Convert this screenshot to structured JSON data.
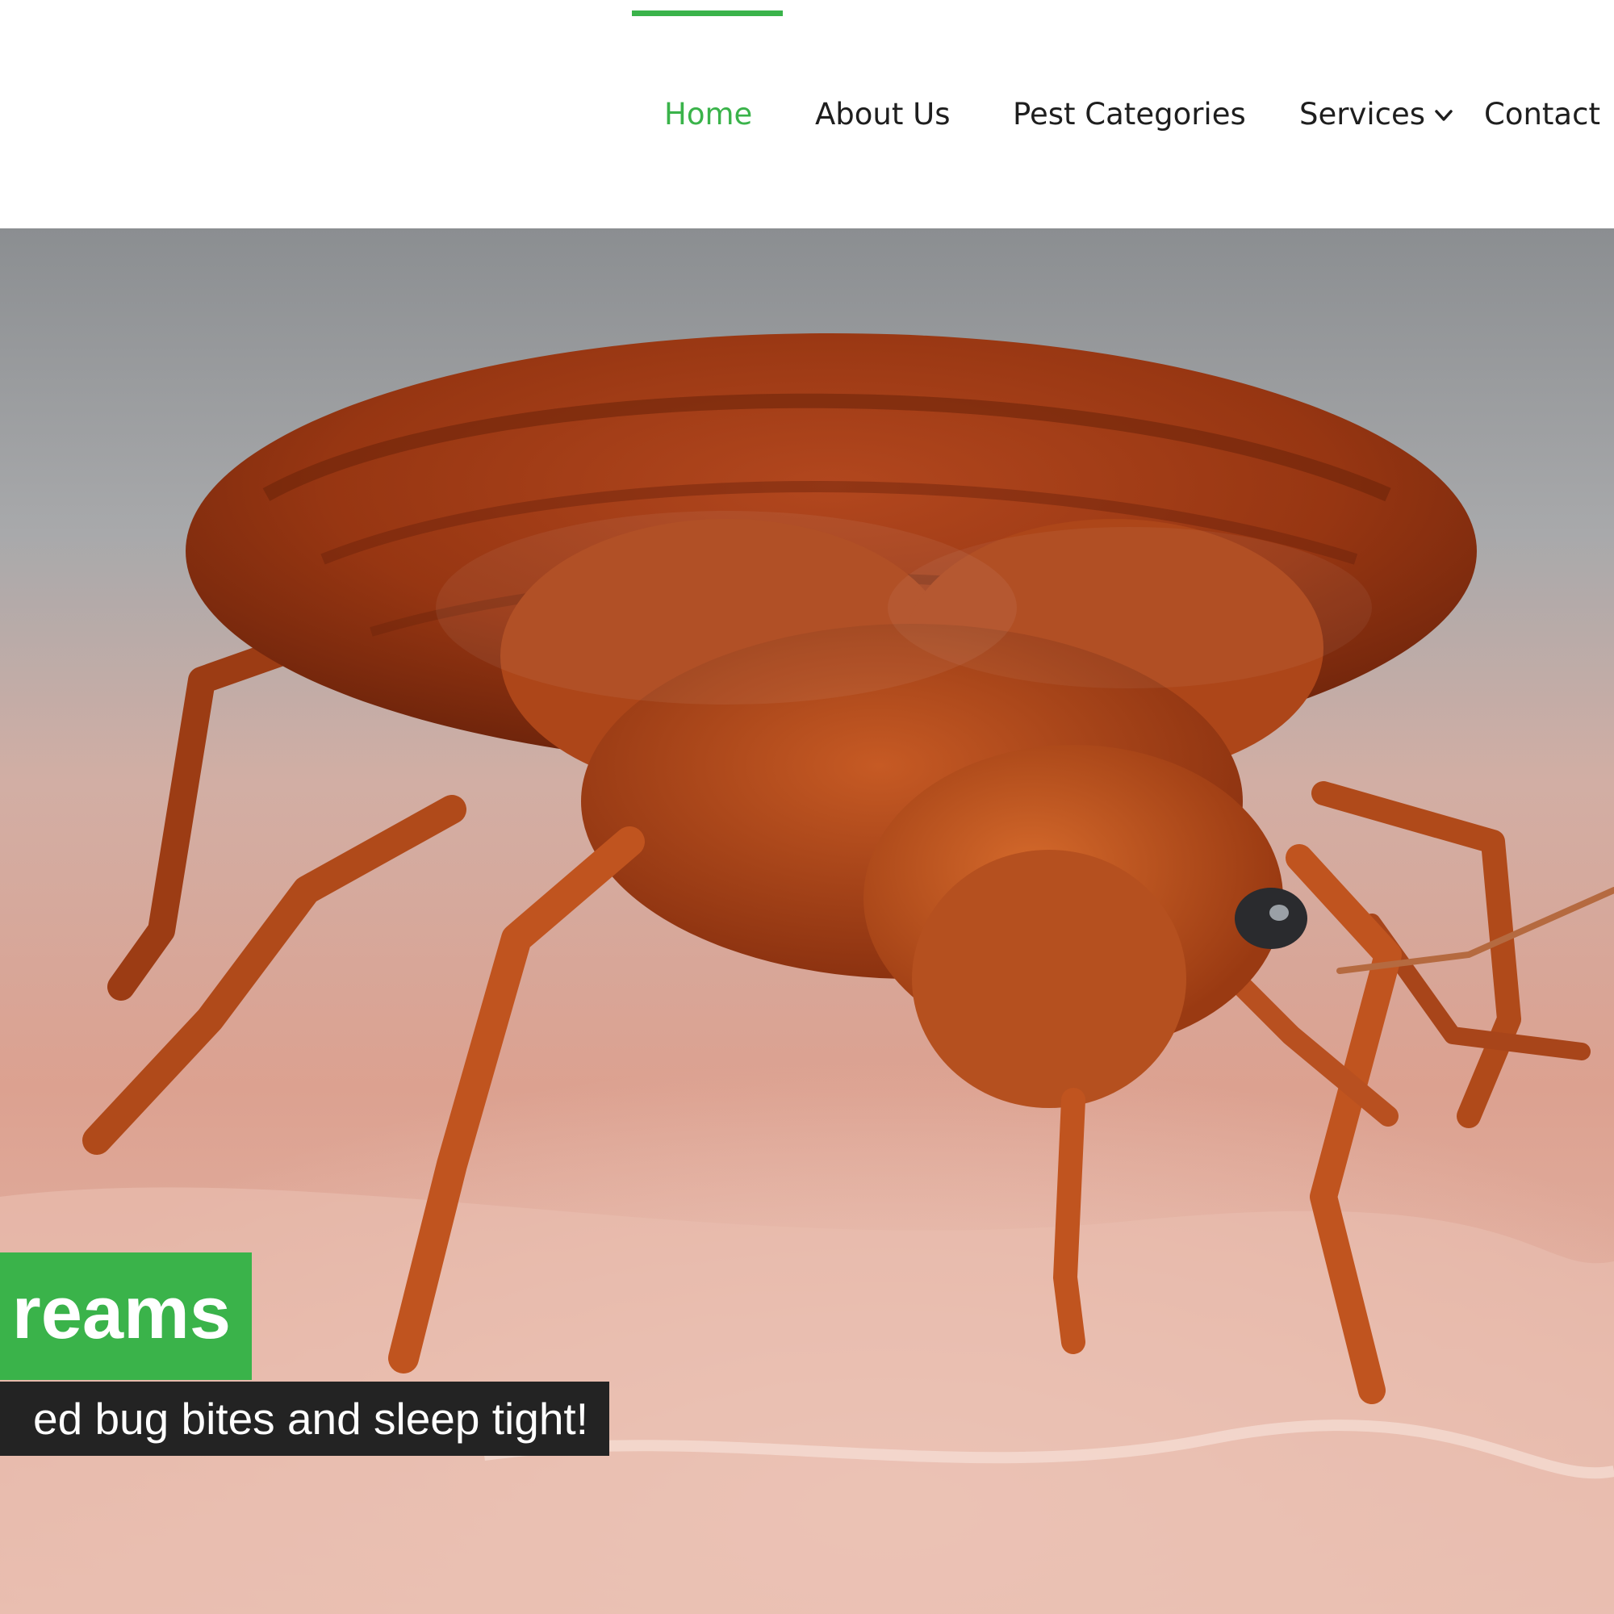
{
  "nav": {
    "items": [
      {
        "label": "Home",
        "active": true
      },
      {
        "label": "About Us",
        "active": false
      },
      {
        "label": "Pest Categories",
        "active": false
      },
      {
        "label": "Services",
        "active": false,
        "has_dropdown": true
      },
      {
        "label": "Contact",
        "active": false
      }
    ],
    "dropdown_icon": "chevron-down-icon"
  },
  "hero": {
    "title": "reams",
    "subtitle": "ed bug bites and sleep tight!"
  },
  "colors": {
    "accent": "#3ab34a",
    "nav_text": "#1e1e1e",
    "subtitle_bg": "#232323",
    "bug": "#b0441a",
    "skin": "#e3aa98"
  }
}
